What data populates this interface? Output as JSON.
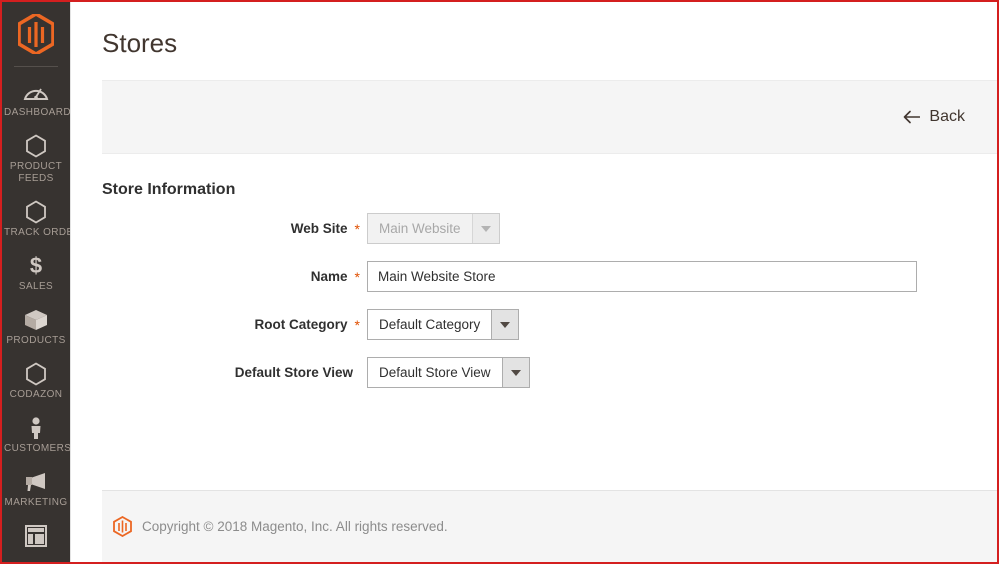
{
  "theme": {
    "sidebar_bg": "#373330",
    "accent_orange": "#ec6723",
    "required_star": "#e04f00",
    "frame_border": "#d41f1f",
    "panel_gray": "#f5f5f5"
  },
  "sidebar": {
    "logo_name": "magento-logo",
    "items": [
      {
        "icon": "dashboard-gauge-icon",
        "label": "DASHBOARD",
        "id": "dashboard"
      },
      {
        "icon": "hexagon-icon",
        "label": "PRODUCT FEEDS",
        "id": "product-feeds"
      },
      {
        "icon": "hexagon-icon",
        "label": "TRACK ORDER",
        "id": "track-order"
      },
      {
        "icon": "dollar-icon",
        "label": "SALES",
        "id": "sales"
      },
      {
        "icon": "box-icon",
        "label": "PRODUCTS",
        "id": "products"
      },
      {
        "icon": "hexagon-icon",
        "label": "CODAZON",
        "id": "codazon"
      },
      {
        "icon": "person-icon",
        "label": "CUSTOMERS",
        "id": "customers"
      },
      {
        "icon": "megaphone-icon",
        "label": "MARKETING",
        "id": "marketing"
      },
      {
        "icon": "content-layout-icon",
        "label": "",
        "id": "content"
      }
    ]
  },
  "header": {
    "title": "Stores"
  },
  "toolbar": {
    "back_label": "Back",
    "back_icon": "arrow-left-icon"
  },
  "form": {
    "section_title": "Store Information",
    "fields": [
      {
        "id": "web-site",
        "label": "Web Site",
        "required": true,
        "type": "select",
        "value": "Main Website",
        "disabled": true
      },
      {
        "id": "name",
        "label": "Name",
        "required": true,
        "type": "text",
        "value": "Main Website Store",
        "placeholder": "",
        "disabled": false
      },
      {
        "id": "root-category",
        "label": "Root Category",
        "required": true,
        "type": "select",
        "value": "Default Category",
        "disabled": false
      },
      {
        "id": "default-store-view",
        "label": "Default Store View",
        "required": false,
        "type": "select",
        "value": "Default Store View",
        "disabled": false
      }
    ],
    "required_marker": "*"
  },
  "footer": {
    "logo_name": "magento-logo-small",
    "copyright": "Copyright © 2018 Magento, Inc. All rights reserved."
  }
}
